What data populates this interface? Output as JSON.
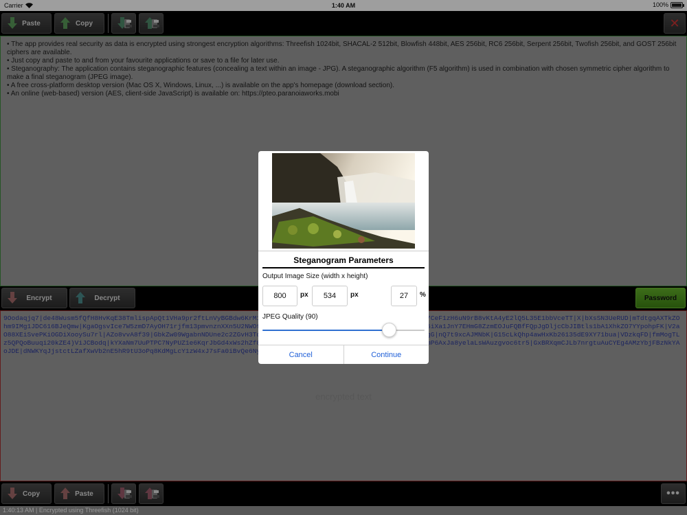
{
  "status_bar": {
    "carrier": "Carrier",
    "time": "1:40 AM",
    "battery": "100%"
  },
  "top_toolbar": {
    "paste": "Paste",
    "copy": "Copy"
  },
  "plaintext_lines": [
    "• The app provides real security as data is encrypted using strongest encryption algorithms: Threefish 1024bit, SHACAL-2 512bit, Blowfish 448bit, AES 256bit, RC6 256bit, Serpent 256bit, Twofish 256bit, and GOST 256bit ciphers are available.",
    "• Just copy and paste to and from your favourite applications or save to a file for later use.",
    "• Steganography: The application contains steganographic features (concealing a text within an image - JPG). A steganographic algorithm (F5 algorithm) is used in combination with chosen symmetric cipher algorithm to make a final steganogram (JPEG image).",
    "• A free cross-platform desktop version (Mac OS X, Windows, Linux, ...) is available on the app's homepage (download section).",
    "• An online (web-based) version (AES, client-side JavaScript) is available on: https://pteo.paranoiaworks.mobi"
  ],
  "middle_toolbar": {
    "encrypt": "Encrypt",
    "decrypt": "Decrypt",
    "password": "Password"
  },
  "ciphertext": "9Oodaqjq7|de48Wusm5fQfH8HvKqE38TmlispApQt1VHa9pr2ftLnVyBGBdw6KrM1pQ7sWxZt0cJbN4hUe8Rf2aYvL9oTq5ImGd3XkS0jPw7CeF1zH6uN9rB8vKtA4yE2lQ5L35E1bbVceTT|X|bXsSN3UeRUD|mTdtgqAXTkZOhm9IMg1JDC616BJeQmw|KgaOgsvIce7W5zmD7AyOH71rjfm13pmvnznXXn5U2NWOfTaFzxv5pu1EqmWTVt8oRjK3dLc7HsQ2mPb9ZuY4NgW6iXa1JnY7EHmG8ZzmEOJuFQBfFQpJgDljcCbJIBtls1bA1XhkZO7YYpohpFK|V2aO88XEiSvePKiOGDiXooySu7rl|AZo8vvA8f39|GbkZw09WgabnNDUne2c2ZGvH3TqR5yW8pLs1KxJ0mN4bA6eD9kA1LIKJKgF7eoSRTr}|QgG|nQ7t9xcAJMNbK|G15cLkQhp4awHxKb26135dE9XY71bua|VDzkqFD|fmMogTLz5QPQoBuuqi20kZE4)ViJCBodq|kYXaNm7UuPTPC7NyPUZ1e6KqrJbGd4xWs2hZf8gPyS3oTl5FP3Nmx6VNKpVumDGoRCu7kqa36INGsMNPmP6AxJa8yelaLsWAuzgvoc6tr5|GxBRXqmCJLb7nrgtuAuCYEg4AMzYbjFBzNkYAoJDE|dNWKYqJjstctLZafXwVb2nE5hR9tU3oPq8KdMgLcY1zW4xJ7sFa0iBvQe6NyT2GmRHpD8ELAugn!",
  "ciphertext_placeholder": "encrypted text",
  "bottom_toolbar": {
    "copy": "Copy",
    "paste": "Paste",
    "more": "•••"
  },
  "bottom_status": "1:40:13 AM | Encrypted using Threefish (1024 bit)",
  "dialog": {
    "title": "Steganogram Parameters",
    "size_label": "Output Image Size (width x height)",
    "width": "800",
    "height": "534",
    "unit": "px",
    "percent": "27",
    "percent_unit": "%",
    "quality_label": "JPEG Quality (90)",
    "quality_fraction": 0.78,
    "cancel": "Cancel",
    "continue": "Continue"
  },
  "colors": {
    "accent": "#2f6fd1",
    "password_button": "#4f9a1c",
    "plain_border": "#3c8a3c",
    "cipher_border": "#a03030",
    "cipher_text": "#2d3a9a"
  }
}
